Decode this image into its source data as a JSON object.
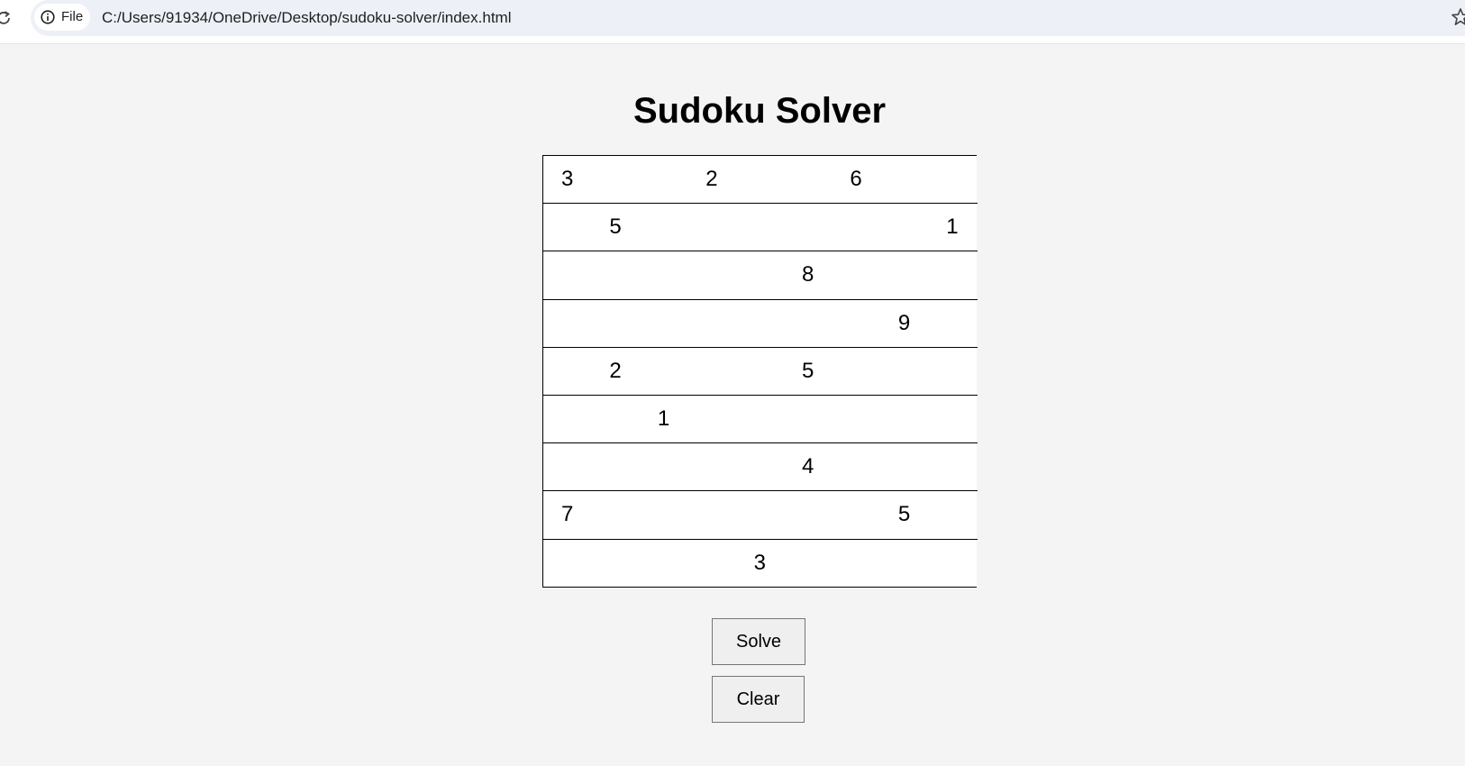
{
  "browser": {
    "site_chip_label": "File",
    "url": "C:/Users/91934/OneDrive/Desktop/sudoku-solver/index.html"
  },
  "page": {
    "title": "Sudoku Solver"
  },
  "grid": {
    "rows": [
      [
        "3",
        "",
        "",
        "2",
        "",
        "",
        "6",
        "",
        ""
      ],
      [
        "",
        "5",
        "",
        "",
        "",
        "",
        "",
        "",
        "1"
      ],
      [
        "",
        "",
        "",
        "",
        "",
        "8",
        "",
        "",
        ""
      ],
      [
        "",
        "",
        "",
        "",
        "",
        "",
        "",
        "9",
        ""
      ],
      [
        "",
        "2",
        "",
        "",
        "",
        "5",
        "",
        "",
        ""
      ],
      [
        "",
        "",
        "1",
        "",
        "",
        "",
        "",
        "",
        ""
      ],
      [
        "",
        "",
        "",
        "",
        "",
        "4",
        "",
        "",
        ""
      ],
      [
        "7",
        "",
        "",
        "",
        "",
        "",
        "",
        "5",
        ""
      ],
      [
        "",
        "",
        "",
        "",
        "3",
        "",
        "",
        "",
        ""
      ]
    ]
  },
  "buttons": {
    "solve_label": "Solve",
    "clear_label": "Clear"
  }
}
